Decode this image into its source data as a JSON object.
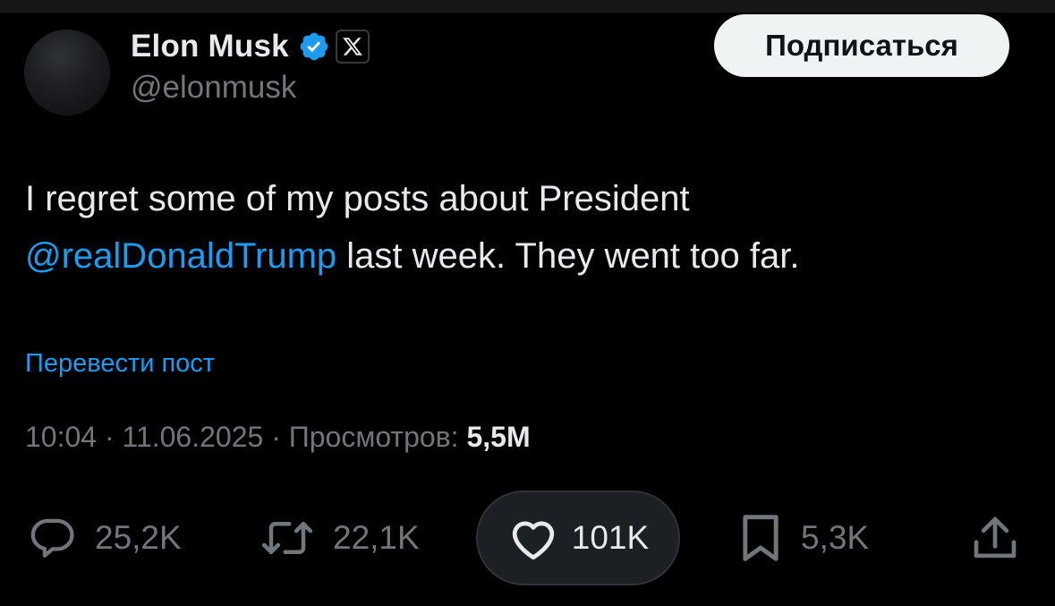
{
  "author": {
    "name": "Elon Musk",
    "handle": "@elonmusk",
    "verified_icon": "verified-badge-icon",
    "affiliation_icon": "x-logo-icon"
  },
  "follow_button": {
    "label": "Подписаться"
  },
  "tweet": {
    "text_line1": "I regret some of my posts about President",
    "mention": "@realDonaldTrump",
    "text_line2_rest": " last week. They went too far."
  },
  "translate_link": "Перевести пост",
  "meta": {
    "time": "10:04",
    "separator": " · ",
    "date": "11.06.2025",
    "views_label": "Просмотров: ",
    "views_value": "5,5M"
  },
  "actions": {
    "reply": {
      "icon": "reply-icon",
      "count": "25,2K"
    },
    "repost": {
      "icon": "repost-icon",
      "count": "22,1K"
    },
    "like": {
      "icon": "heart-icon",
      "count": "101K"
    },
    "bookmark": {
      "icon": "bookmark-icon",
      "count": "5,3K"
    },
    "share": {
      "icon": "share-icon"
    }
  },
  "colors": {
    "background": "#000000",
    "text_primary": "#e7e9ea",
    "text_secondary": "#71767b",
    "accent": "#1d9bf0",
    "button_bg": "#eff3f4"
  }
}
